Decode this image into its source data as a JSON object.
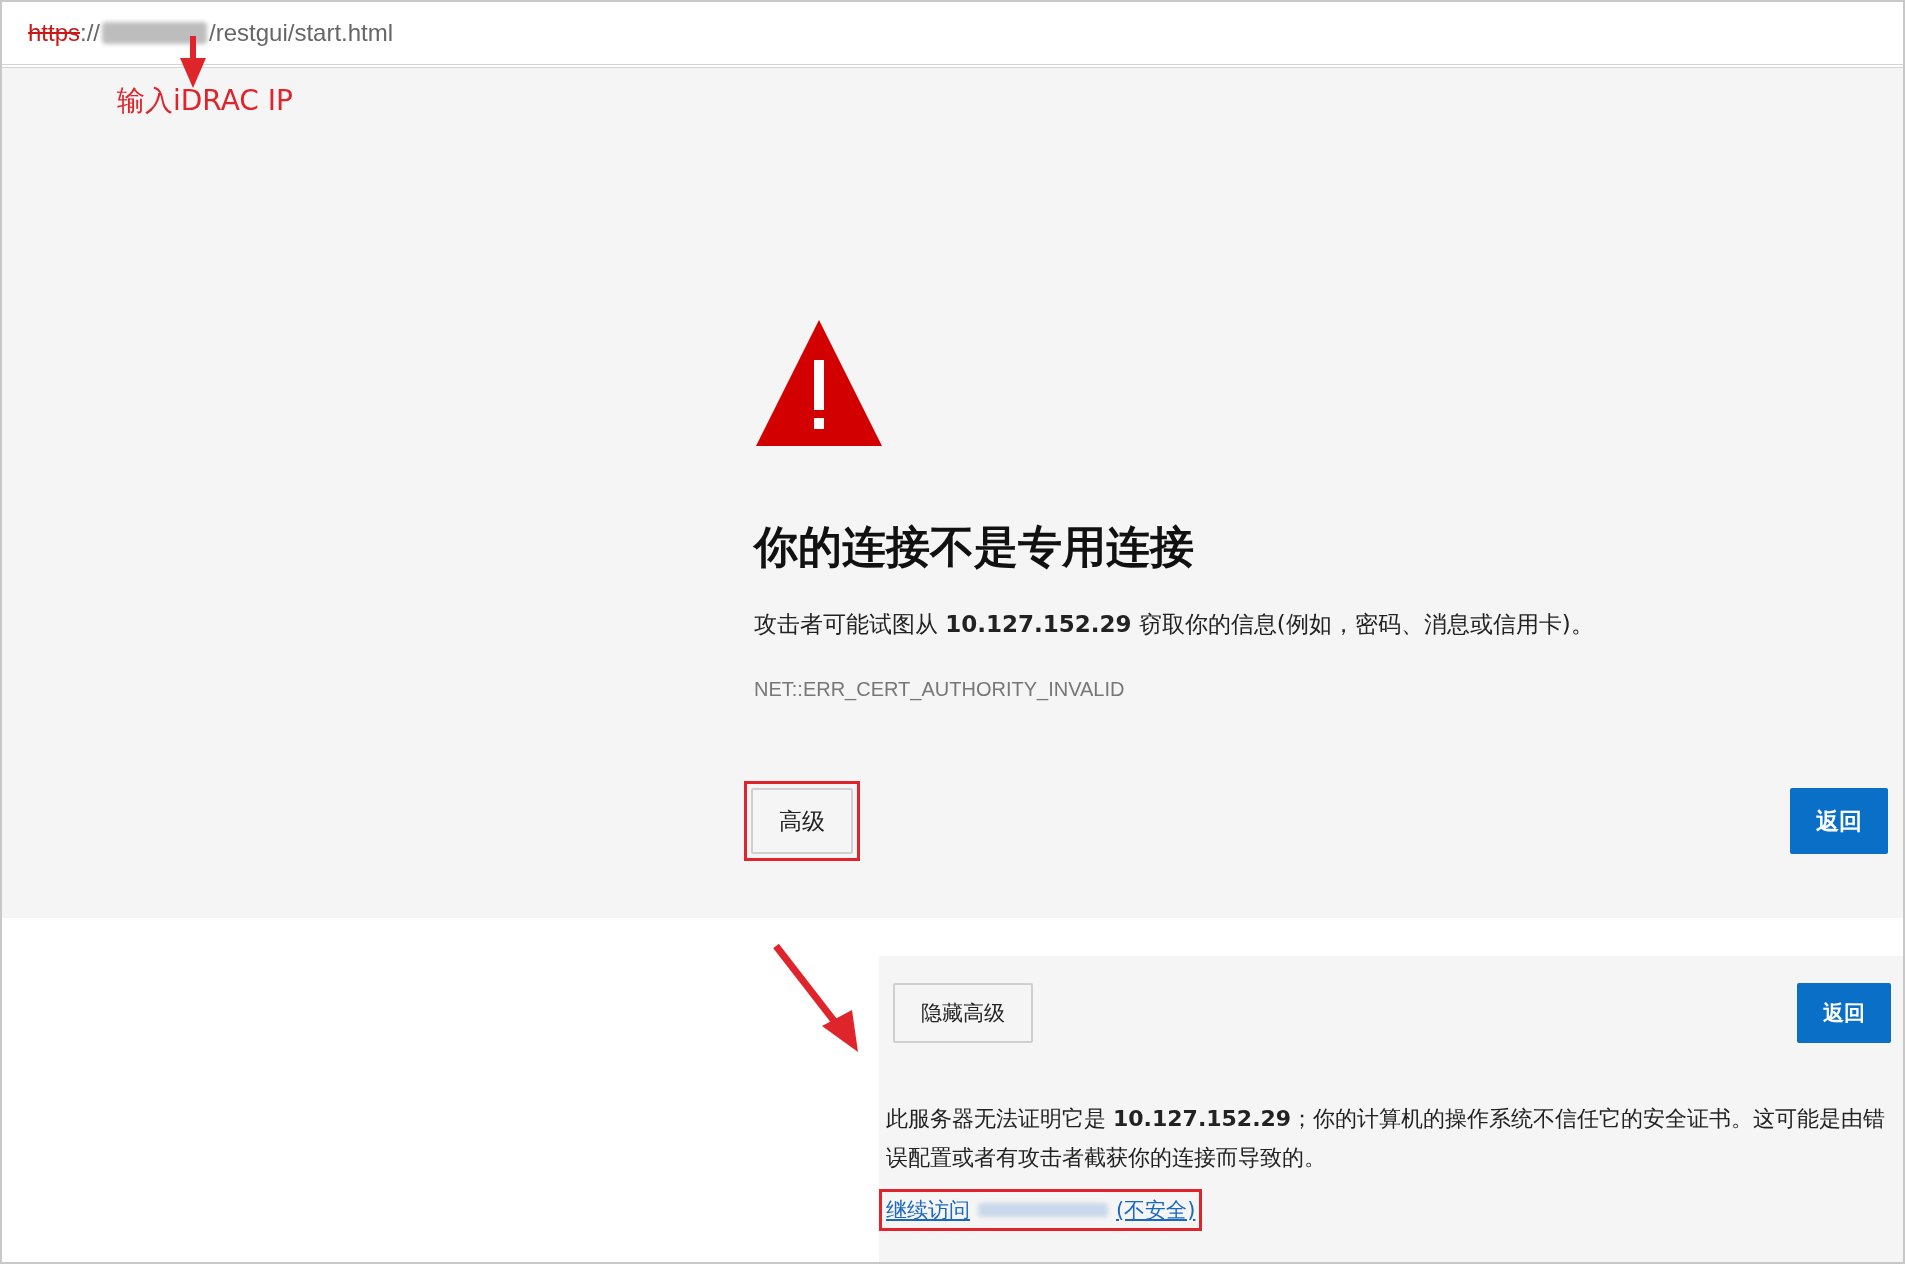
{
  "address_bar": {
    "scheme": "https",
    "separator": "://",
    "path": "/restgui/start.html"
  },
  "annotation": {
    "label": "输入iDRAC IP"
  },
  "warning": {
    "title": "你的连接不是专用连接",
    "message": "攻击者可能试图从 **10.127.152.29** 窃取你的信息(例如，密码、消息或信用卡)。",
    "error_code": "NET::ERR_CERT_AUTHORITY_INVALID",
    "buttons": [
      {
        "label": "高级",
        "kind": "secondary",
        "highlighted": true
      },
      {
        "label": "返回",
        "kind": "primary",
        "highlighted": false
      }
    ]
  },
  "advanced_panel": {
    "buttons": [
      {
        "label": "隐藏高级",
        "kind": "secondary",
        "highlighted": false
      },
      {
        "label": "返回",
        "kind": "primary",
        "highlighted": false
      }
    ],
    "message": "此服务器无法证明它是 **10.127.152.29**；你的计算机的操作系统不信任它的安全证书。这可能是由错误配置或者有攻击者截获你的连接而导致的。",
    "link": {
      "prefix": "继续访问",
      "suffix": "(不安全)",
      "highlighted": true
    }
  }
}
